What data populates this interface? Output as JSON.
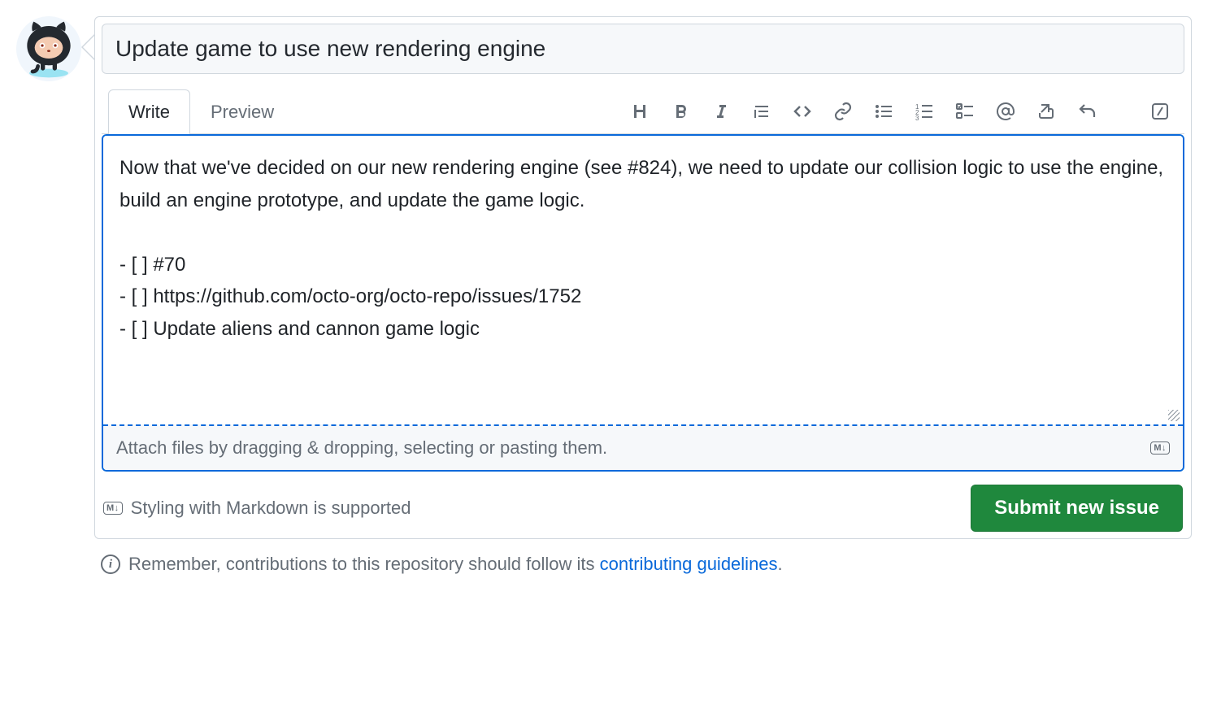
{
  "title": "Update game to use new rendering engine",
  "tabs": {
    "write": "Write",
    "preview": "Preview"
  },
  "body": "Now that we've decided on our new rendering engine (see #824), we need to update our collision logic to use the engine, build an engine prototype, and update the game logic.\n\n- [ ] #70\n- [ ] https://github.com/octo-org/octo-repo/issues/1752\n- [ ] Update aliens and cannon game logic",
  "attach_hint": "Attach files by dragging & dropping, selecting or pasting them.",
  "markdown_badge": "M↓",
  "markdown_support": "Styling with Markdown is supported",
  "submit_label": "Submit new issue",
  "guidelines": {
    "prefix": "Remember, contributions to this repository should follow its ",
    "link": "contributing guidelines",
    "suffix": "."
  },
  "toolbar_icons": [
    "heading-icon",
    "bold-icon",
    "italic-icon",
    "quote-icon",
    "code-icon",
    "link-icon",
    "unordered-list-icon",
    "ordered-list-icon",
    "task-list-icon",
    "mention-icon",
    "cross-reference-icon",
    "reply-icon",
    "slash-icon"
  ]
}
